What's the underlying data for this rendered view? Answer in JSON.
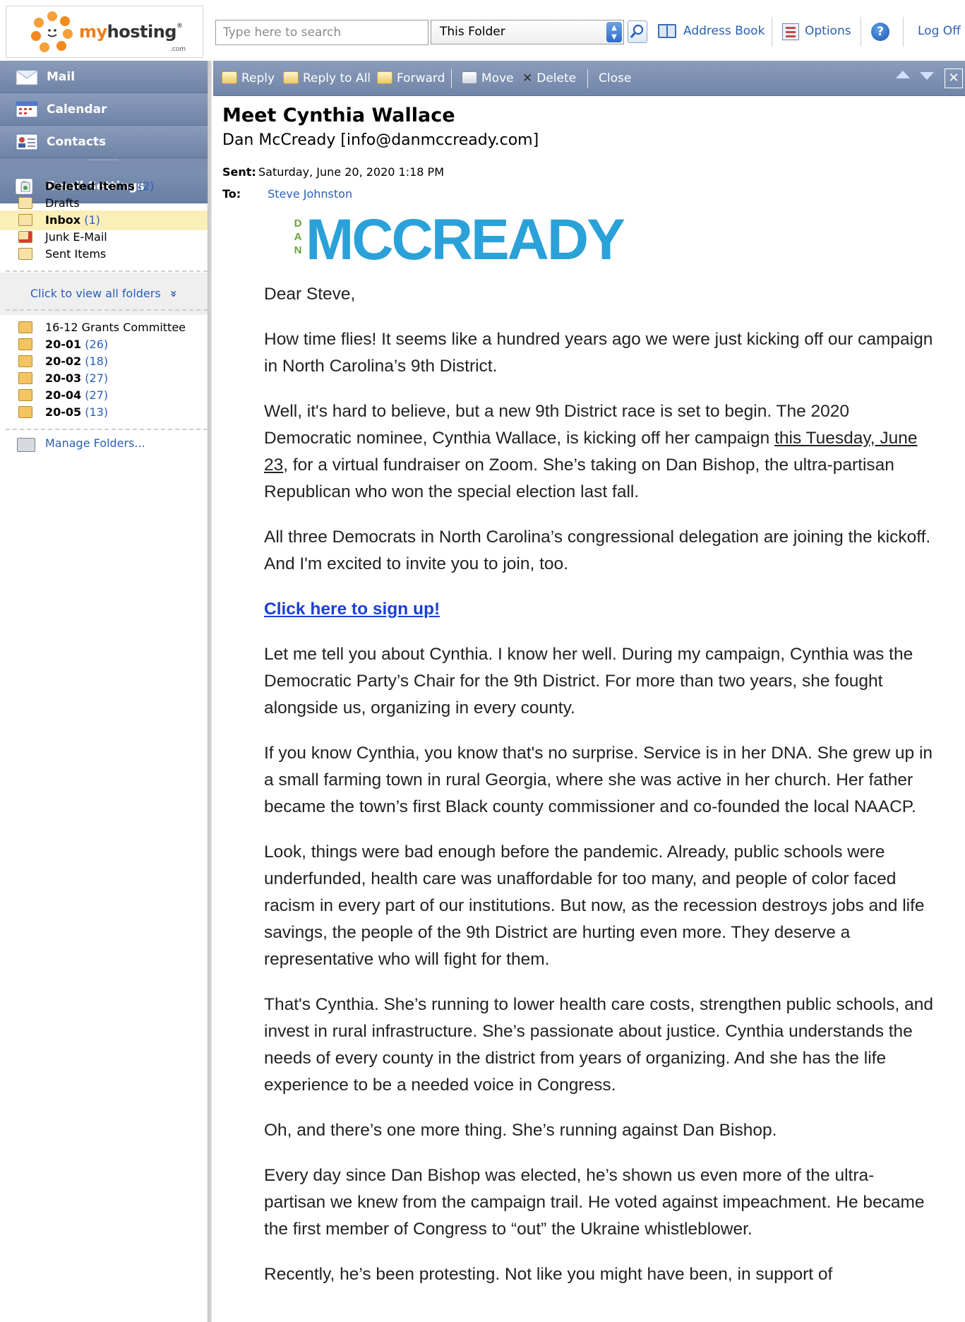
{
  "header": {
    "logo_prefix": "my",
    "logo_rest": "hosting",
    "logo_reg": "®",
    "logo_dotcom": ".com",
    "search_placeholder": "Type here to search",
    "scope_value": "This Folder",
    "links": {
      "address_book": "Address Book",
      "options": "Options",
      "help_glyph": "?",
      "log_off": "Log Off"
    }
  },
  "nav": {
    "buttons": {
      "mail": "Mail",
      "calendar": "Calendar",
      "contacts": "Contacts",
      "settings": "Email Settings"
    },
    "grip": "··········",
    "folders": [
      {
        "name": "Deleted Items",
        "count": "(2)",
        "bold": true
      },
      {
        "name": "Drafts",
        "count": "",
        "bold": false
      },
      {
        "name": "Inbox",
        "count": "(1)",
        "bold": true,
        "selected": true
      },
      {
        "name": "Junk E-Mail",
        "count": "",
        "bold": false
      },
      {
        "name": "Sent Items",
        "count": "",
        "bold": false
      }
    ],
    "view_all": "Click to view all folders",
    "view_all_glyph": "»",
    "custom_folders": [
      {
        "name": "16-12 Grants Committee",
        "count": "",
        "bold": false
      },
      {
        "name": "20-01",
        "count": "(26)",
        "bold": true
      },
      {
        "name": "20-02",
        "count": "(18)",
        "bold": true
      },
      {
        "name": "20-03",
        "count": "(27)",
        "bold": true
      },
      {
        "name": "20-04",
        "count": "(27)",
        "bold": true
      },
      {
        "name": "20-05",
        "count": "(13)",
        "bold": true
      }
    ],
    "manage": "Manage Folders..."
  },
  "toolbar": {
    "reply": "Reply",
    "reply_all": "Reply to All",
    "forward": "Forward",
    "move": "Move",
    "delete": "Delete",
    "close": "Close",
    "close_glyph": "✕"
  },
  "message": {
    "subject": "Meet Cynthia Wallace",
    "from": "Dan McCready [info@danmccready.com]",
    "sent_label": "Sent:",
    "sent": "Saturday, June 20, 2020 1:18 PM",
    "to_label": "To:",
    "to": "Steve Johnston",
    "brand_small": [
      "D",
      "A",
      "N"
    ],
    "brand_name": "MCCREADY",
    "greeting": "Dear Steve,",
    "p1": "How time flies! It seems like a hundred years ago we were just kicking off our campaign in North Carolina’s 9th District.",
    "p2_a": "Well, it's hard to believe, but a new 9th District race is set to begin. The 2020 Democratic nominee, Cynthia Wallace, is kicking off her campaign ",
    "p2_u": "this Tuesday, June 23",
    "p2_b": ", for a virtual fundraiser on Zoom. She’s taking on Dan Bishop, the ultra-partisan Republican who won the special election last fall.",
    "p3": "All three Democrats in North Carolina’s congressional delegation are joining the kickoff. And I'm excited to invite you to join, too.",
    "signup": "Click here to sign up!",
    "p4": "Let me tell you about Cynthia. I know her well. During my campaign, Cynthia was the Democratic Party’s Chair for the 9th District. For more than two years, she fought alongside us, organizing in every county.",
    "p5": "If you know Cynthia, you know that's no surprise. Service is in her DNA. She grew up in a small farming town in rural Georgia, where she was active in her church. Her father became the town’s first Black county commissioner and co-founded the local NAACP.",
    "p6": "Look, things were bad enough before the pandemic. Already, public schools were underfunded, health care was unaffordable for too many, and people of color faced racism in every part of our institutions. But now, as the recession destroys jobs and life savings, the people of the 9th District are hurting even more. They deserve a representative who will fight for them.",
    "p7": "That's Cynthia. She’s running to lower health care costs, strengthen public schools, and invest in rural infrastructure. She’s passionate about justice. Cynthia understands the needs of every county in the district from years of organizing. And she has the life experience to be a needed voice in Congress.",
    "p8": "Oh, and there’s one more thing. She’s running against Dan Bishop.",
    "p9": "Every day since Dan Bishop was elected, he’s shown us even more of the ultra-partisan we knew from the campaign trail. He voted against impeachment. He became the first member of Congress to “out” the Ukraine whistleblower.",
    "p10": "Recently, he’s been protesting. Not like you might have been, in support of"
  }
}
